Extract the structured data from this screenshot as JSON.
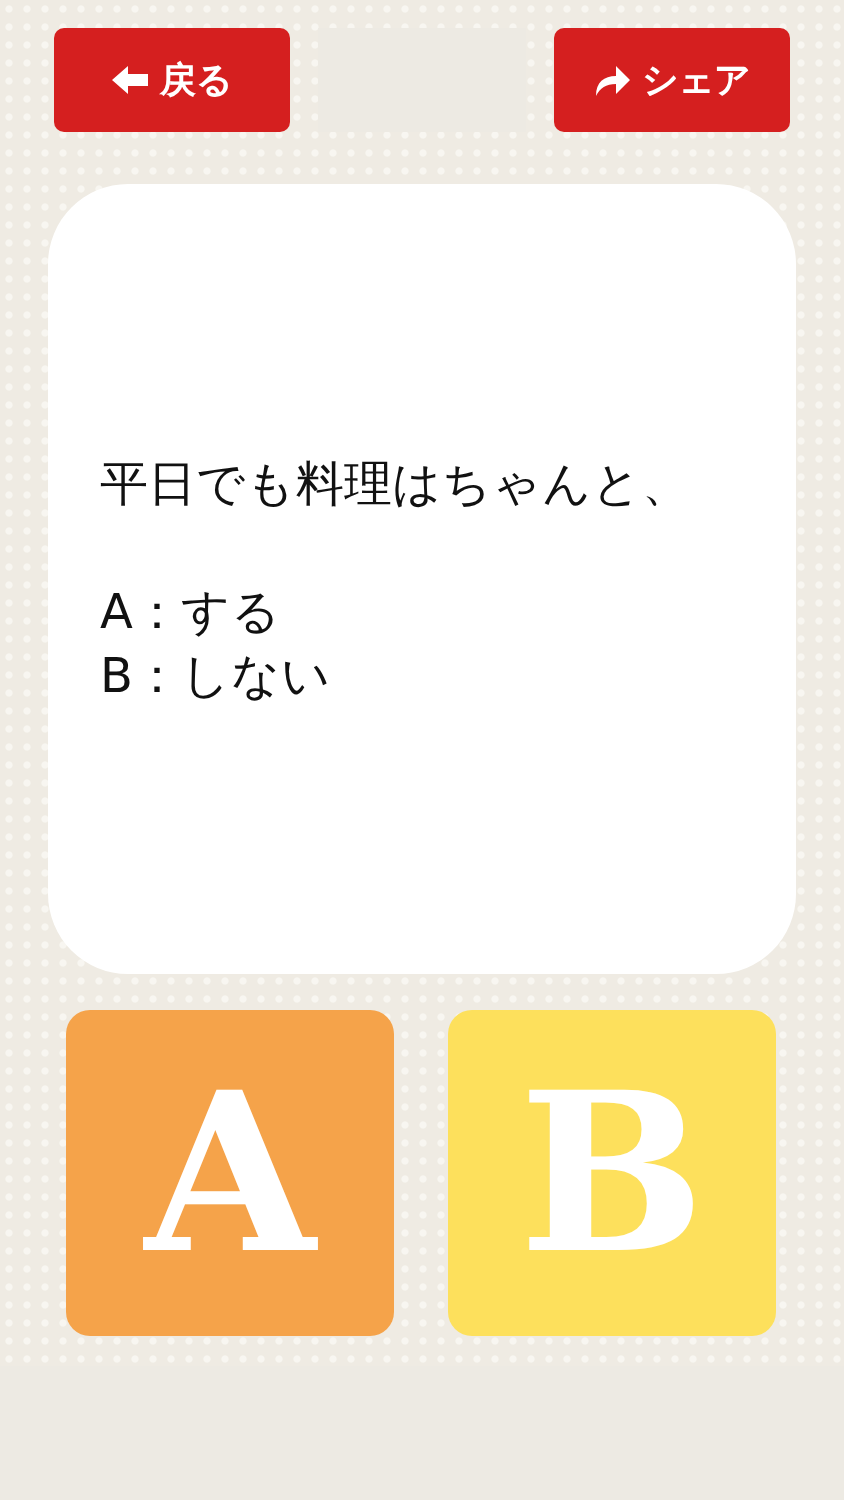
{
  "header": {
    "buttons": [
      {
        "kind": "back",
        "label": "戻る"
      },
      {
        "kind": "share",
        "label": "シェア"
      }
    ]
  },
  "question": {
    "text": "平日でも料理はちゃんと、\n\nA：する\nB：しない"
  },
  "answers": [
    {
      "label": "A",
      "color": "#f5a34a"
    },
    {
      "label": "B",
      "color": "#fde05c"
    }
  ]
}
